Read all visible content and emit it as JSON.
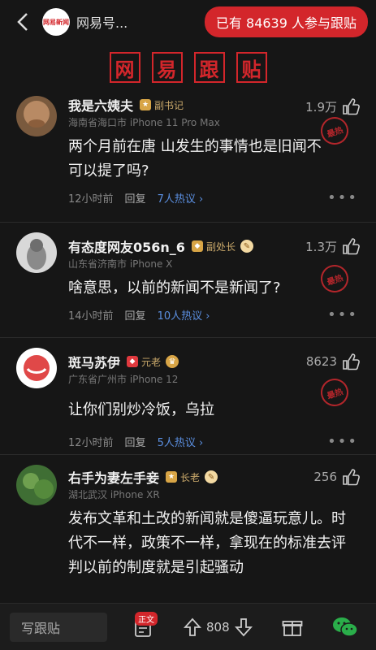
{
  "header": {
    "source_name": "网易号...",
    "logo_text": "网易新闻",
    "join_label": "已有 84639 人参与跟贴"
  },
  "banner": [
    "网",
    "易",
    "跟",
    "贴"
  ],
  "comments": [
    {
      "username": "我是六姨夫",
      "badge": "副书记",
      "meta": "海南省海口市  iPhone 11 Pro Max",
      "likes": "1.9万",
      "text": "两个月前在唐 山发生的事情也是旧闻不可以提了吗?",
      "time": "12小时前",
      "reply": "回复",
      "hot_replies": "7人热议 ›",
      "stamp": "最热"
    },
    {
      "username": "有态度网友056n_6",
      "badge": "副处长",
      "meta": "山东省济南市  iPhone X",
      "likes": "1.3万",
      "text": "啥意思，以前的新闻不是新闻了?",
      "time": "14小时前",
      "reply": "回复",
      "hot_replies": "10人热议 ›",
      "stamp": "最热"
    },
    {
      "username": "斑马苏伊",
      "badge": "元老",
      "meta": "广东省广州市  iPhone 12",
      "likes": "8623",
      "text": "让你们别炒冷饭，乌拉",
      "time": "12小时前",
      "reply": "回复",
      "hot_replies": "5人热议 ›",
      "stamp": "最热"
    },
    {
      "username": "右手为妻左手妾",
      "badge": "长老",
      "meta": "湖北武汉  iPhone XR",
      "likes": "256",
      "text": "发布文革和土改的新闻就是傻逼玩意儿。时代不一样，政策不一样，拿现在的标准去评判以前的制度就是引起骚动"
    }
  ],
  "bottom": {
    "write_label": "写跟贴",
    "body_tag": "正文",
    "vote_count": "808"
  }
}
